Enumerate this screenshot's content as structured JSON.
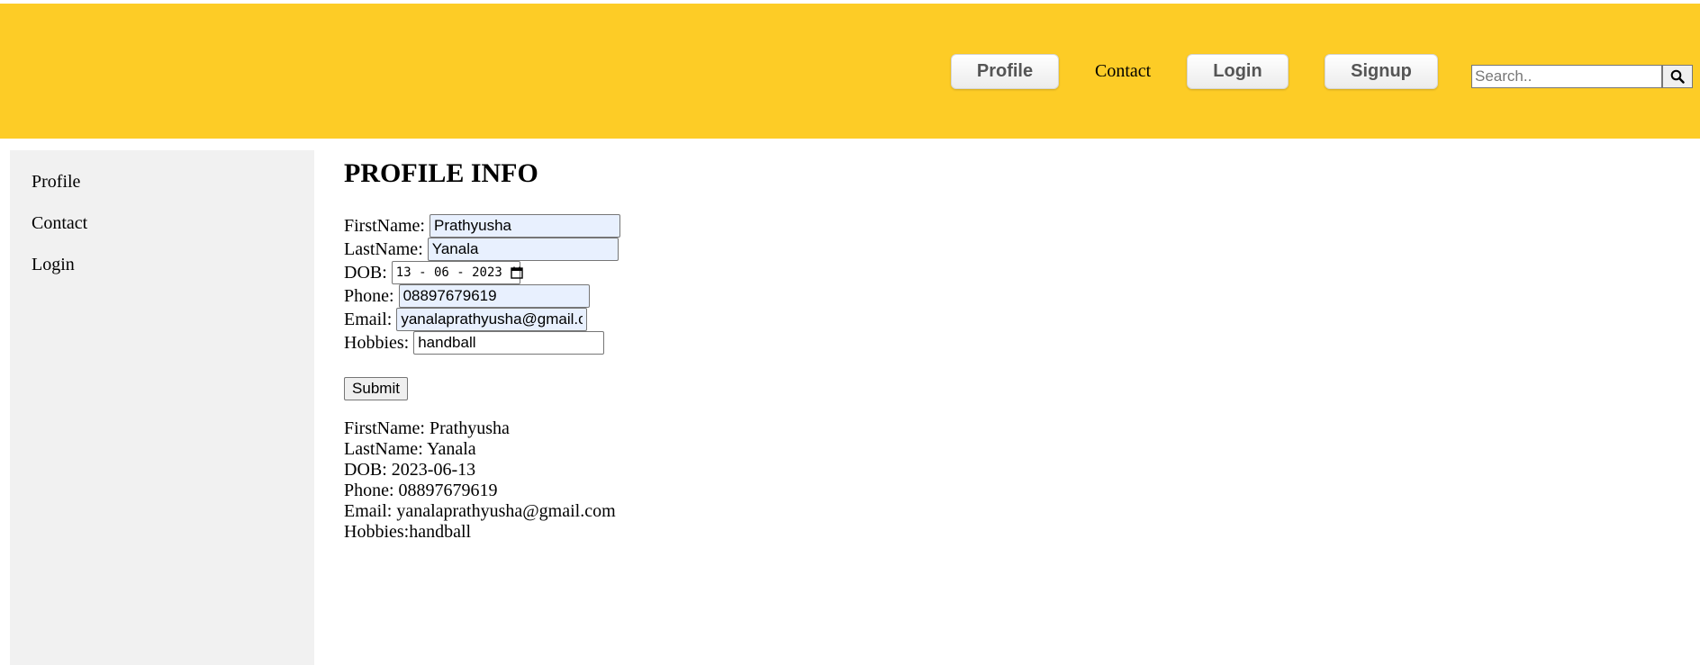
{
  "header": {
    "nav": {
      "profile_label": "Profile",
      "contact_label": "Contact",
      "login_label": "Login",
      "signup_label": "Signup"
    },
    "search": {
      "placeholder": "Search..",
      "icon": "search-icon"
    },
    "colors": {
      "background": "#fdcc26"
    }
  },
  "sidebar": {
    "items": [
      {
        "label": "Profile"
      },
      {
        "label": "Contact"
      },
      {
        "label": "Login"
      }
    ]
  },
  "main": {
    "title": "PROFILE INFO",
    "form": {
      "firstname_label": "FirstName:",
      "firstname_value": "Prathyusha",
      "lastname_label": "LastName:",
      "lastname_value": "Yanala",
      "dob_label": "DOB:",
      "dob_value": "13 - 06 - 2023",
      "phone_label": "Phone:",
      "phone_value": "08897679619",
      "email_label": "Email:",
      "email_value": "yanalaprathyusha@gmail.com",
      "hobbies_label": "Hobbies:",
      "hobbies_value": "handball",
      "submit_label": "Submit"
    },
    "output": {
      "firstname": "FirstName: Prathyusha",
      "lastname": "LastName: Yanala",
      "dob": "DOB: 2023-06-13",
      "phone": "Phone: 08897679619",
      "email": "Email: yanalaprathyusha@gmail.com",
      "hobbies": "Hobbies:handball"
    }
  }
}
